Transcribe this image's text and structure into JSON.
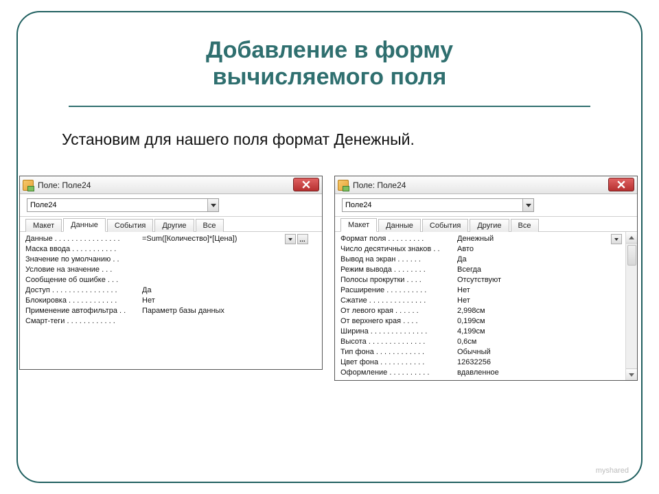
{
  "slide": {
    "title_line1": "Добавление в форму",
    "title_line2": "вычисляемого поля",
    "body": "Установим для нашего поля формат Денежный."
  },
  "left_window": {
    "title": "Поле: Поле24",
    "selector_value": "Поле24",
    "tabs": [
      "Макет",
      "Данные",
      "События",
      "Другие",
      "Все"
    ],
    "active_tab_index": 1,
    "rows": [
      {
        "label": "Данные",
        "value": "=Sum([Количество]*[Цена])"
      },
      {
        "label": "Маска ввода",
        "value": ""
      },
      {
        "label": "Значение по умолчанию",
        "value": ""
      },
      {
        "label": "Условие на значение",
        "value": ""
      },
      {
        "label": "Сообщение об ошибке",
        "value": ""
      },
      {
        "label": "Доступ",
        "value": "Да"
      },
      {
        "label": "Блокировка",
        "value": "Нет"
      },
      {
        "label": "Применение автофильтра",
        "value": "Параметр базы данных"
      },
      {
        "label": "Смарт-теги",
        "value": ""
      }
    ]
  },
  "right_window": {
    "title": "Поле: Поле24",
    "selector_value": "Поле24",
    "tabs": [
      "Макет",
      "Данные",
      "События",
      "Другие",
      "Все"
    ],
    "active_tab_index": 0,
    "rows": [
      {
        "label": "Формат поля",
        "value": "Денежный"
      },
      {
        "label": "Число десятичных знаков",
        "value": "Авто"
      },
      {
        "label": "Вывод на экран",
        "value": "Да"
      },
      {
        "label": "Режим вывода",
        "value": "Всегда"
      },
      {
        "label": "Полосы прокрутки",
        "value": "Отсутствуют"
      },
      {
        "label": "Расширение",
        "value": "Нет"
      },
      {
        "label": "Сжатие",
        "value": "Нет"
      },
      {
        "label": "От левого края",
        "value": "2,998см"
      },
      {
        "label": "От верхнего края",
        "value": "0,199см"
      },
      {
        "label": "Ширина",
        "value": "4,199см"
      },
      {
        "label": "Высота",
        "value": "0,6см"
      },
      {
        "label": "Тип фона",
        "value": "Обычный"
      },
      {
        "label": "Цвет фона",
        "value": "12632256"
      },
      {
        "label": "Оформление",
        "value": "вдавленное"
      }
    ]
  },
  "watermark": "myshared"
}
